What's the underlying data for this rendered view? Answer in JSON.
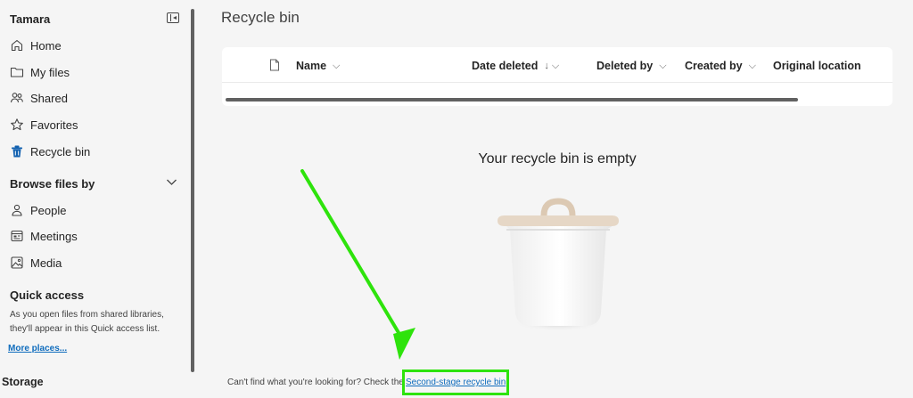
{
  "sidebar": {
    "user_name": "Tamara",
    "nav": [
      {
        "label": "Home",
        "icon": "home-icon"
      },
      {
        "label": "My files",
        "icon": "folder-icon"
      },
      {
        "label": "Shared",
        "icon": "people-shared-icon"
      },
      {
        "label": "Favorites",
        "icon": "star-icon"
      },
      {
        "label": "Recycle bin",
        "icon": "recycle-bin-icon"
      }
    ],
    "browse_heading": "Browse files by",
    "browse": [
      {
        "label": "People",
        "icon": "person-icon"
      },
      {
        "label": "Meetings",
        "icon": "calendar-icon"
      },
      {
        "label": "Media",
        "icon": "image-icon"
      }
    ],
    "quick_access_heading": "Quick access",
    "quick_access_text": "As you open files from shared libraries, they'll appear in this Quick access list.",
    "more_places": "More places...",
    "storage_heading": "Storage"
  },
  "main": {
    "title": "Recycle bin",
    "columns": [
      {
        "label": "Name",
        "sym": "⌵"
      },
      {
        "label": "Date deleted",
        "sym": "↓  ⌵"
      },
      {
        "label": "Deleted by",
        "sym": "⌵"
      },
      {
        "label": "Created by",
        "sym": "⌵"
      },
      {
        "label": "Original location",
        "sym": ""
      }
    ],
    "empty_message": "Your recycle bin is empty",
    "bottom_text": "Can't find what you're looking for? Check the",
    "second_stage_link": "Second-stage recycle bin"
  },
  "colors": {
    "accent": "#0f6cbd",
    "highlight": "#2ee30c"
  }
}
